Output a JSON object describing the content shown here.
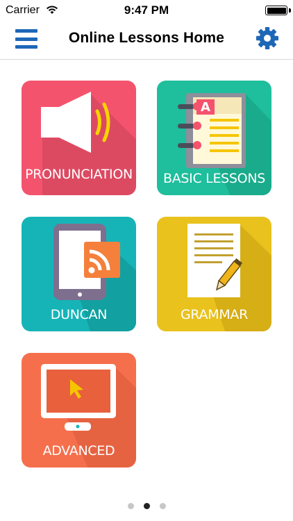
{
  "status_bar": {
    "carrier": "Carrier",
    "time": "9:47 PM",
    "battery_level": 1.0
  },
  "nav": {
    "title": "Online Lessons Home",
    "menu_icon": "hamburger-menu-icon",
    "settings_icon": "gear-icon",
    "accent_color": "#1e67b7"
  },
  "tiles": [
    {
      "label": "PRONUNCIATION",
      "icon": "speaker-icon",
      "color": "#f4536e"
    },
    {
      "label": "BASIC LESSONS",
      "icon": "notebook-icon",
      "color": "#1fbe9c"
    },
    {
      "label": "DUNCAN",
      "icon": "tablet-rss-icon",
      "color": "#16b4b7"
    },
    {
      "label": "GRAMMAR",
      "icon": "document-pencil-icon",
      "color": "#e9c21d"
    },
    {
      "label": "ADVANCED",
      "icon": "monitor-cursor-icon",
      "color": "#f56f4c"
    }
  ],
  "pager": {
    "pages": 3,
    "current_page": 2
  }
}
